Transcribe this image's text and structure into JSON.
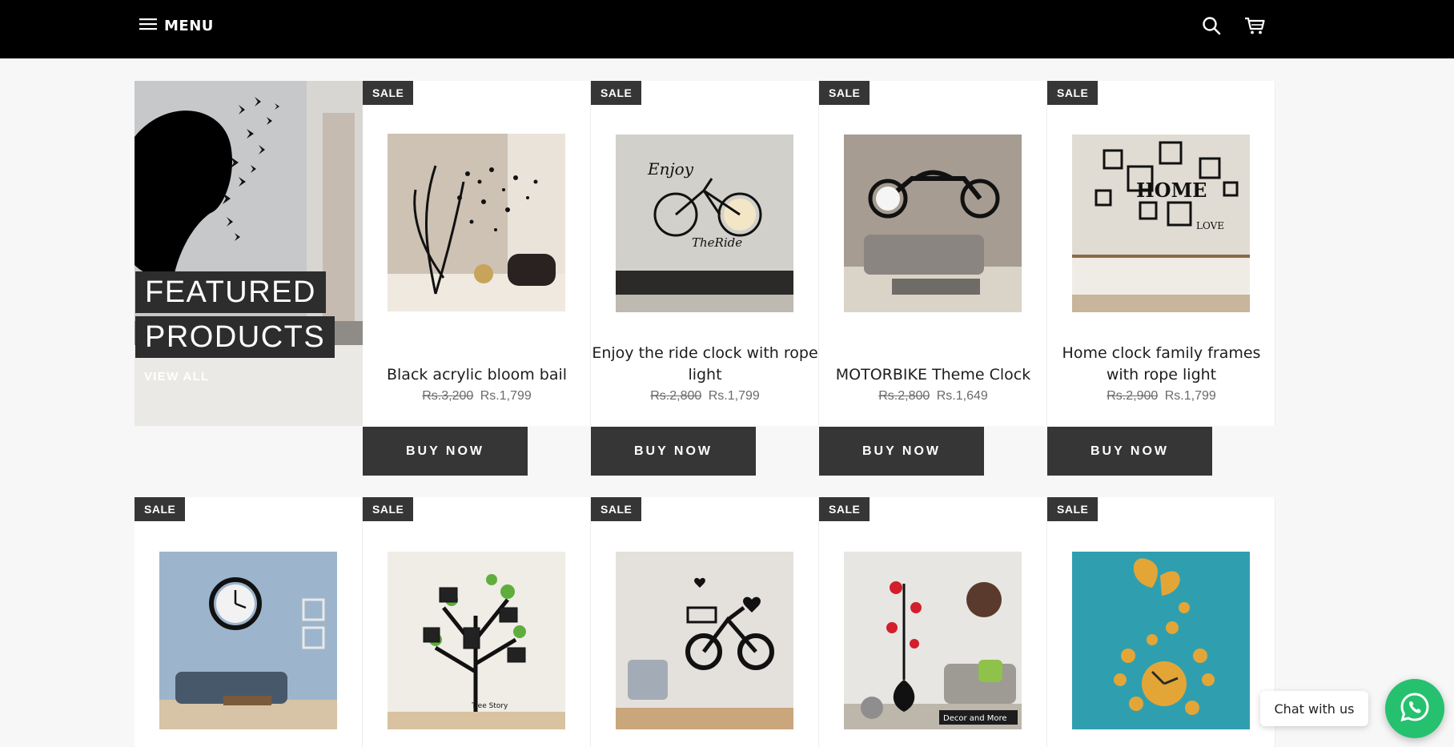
{
  "header": {
    "menu_label": "MENU",
    "icons": [
      "hamburger-icon",
      "search-icon",
      "cart-icon"
    ]
  },
  "featured": {
    "title_line1": "FEATURED",
    "title_line2": "PRODUCTS",
    "view_all": "VIEW ALL"
  },
  "products": [
    {
      "badge": "SALE",
      "title": "Black acrylic bloom bail",
      "old_price": "Rs.3,200",
      "price": "Rs.1,799",
      "button": "BUY NOW"
    },
    {
      "badge": "SALE",
      "title": "Enjoy the ride clock with rope light",
      "old_price": "Rs.2,800",
      "price": "Rs.1,799",
      "button": "BUY NOW"
    },
    {
      "badge": "SALE",
      "title": "MOTORBIKE Theme Clock",
      "old_price": "Rs.2,800",
      "price": "Rs.1,649",
      "button": "BUY NOW"
    },
    {
      "badge": "SALE",
      "title": "Home clock family frames with rope light",
      "old_price": "Rs.2,900",
      "price": "Rs.1,799",
      "button": "BUY NOW"
    }
  ],
  "second_row": [
    {
      "badge": "SALE"
    },
    {
      "badge": "SALE"
    },
    {
      "badge": "SALE"
    },
    {
      "badge": "SALE"
    },
    {
      "badge": "SALE"
    }
  ],
  "image_text": {
    "enjoy": "Enjoy",
    "the_ride": "TheRide",
    "home": "HOME",
    "love": "LOVE",
    "tree_story": "Tree Story",
    "decor_label": "Decor and More"
  },
  "chat": {
    "label": "Chat with us"
  }
}
